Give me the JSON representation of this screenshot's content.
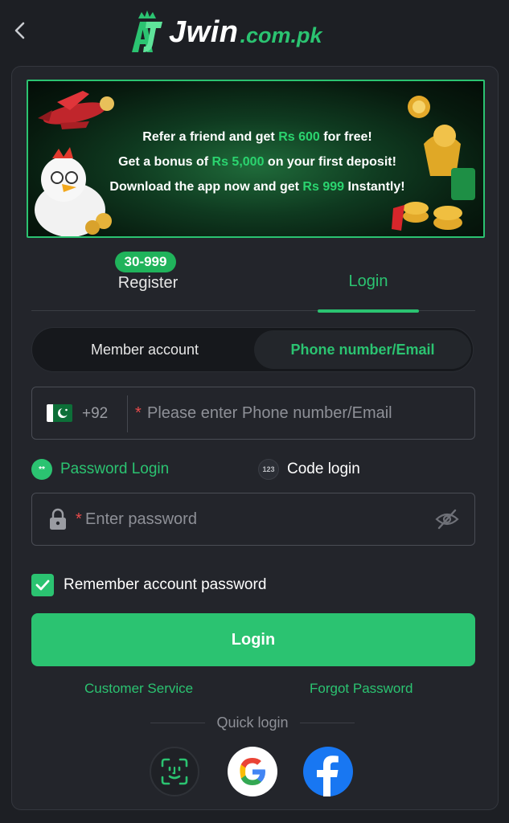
{
  "brand": {
    "logo_word": "Jwin",
    "logo_domain": ".com.pk"
  },
  "banner": {
    "line1": {
      "pre": "Refer a friend and get ",
      "hl": "Rs 600",
      "post": " for free!"
    },
    "line2": {
      "pre": "Get a bonus of ",
      "hl": "Rs 5,000",
      "post": " on your first deposit!"
    },
    "line3": {
      "pre": "Download the app now and get ",
      "hl": "Rs 999",
      "post": " Instantly!"
    }
  },
  "tabs": {
    "register_badge": "30-999",
    "register_label": "Register",
    "login_label": "Login",
    "active": "Login"
  },
  "account_type": {
    "member": "Member account",
    "phone": "Phone number/Email",
    "active": "Phone number/Email"
  },
  "phone_field": {
    "country_code": "+92",
    "required_mark": "*",
    "placeholder": "Please enter Phone number/Email",
    "value": ""
  },
  "login_mode": {
    "password_label": "Password Login",
    "password_icon": "**",
    "code_label": "Code login",
    "code_icon": "123",
    "active": "Password Login"
  },
  "password_field": {
    "required_mark": "*",
    "placeholder": "Enter password",
    "value": ""
  },
  "remember": {
    "label": "Remember account password",
    "checked": true
  },
  "login_button": "Login",
  "links": {
    "customer_service": "Customer Service",
    "forgot_password": "Forgot Password"
  },
  "quick_login": {
    "label": "Quick login",
    "providers": [
      "face-id-icon",
      "google-icon",
      "facebook-icon"
    ]
  },
  "colors": {
    "accent": "#2bc371",
    "background": "#1d1f24",
    "panel": "#23252b",
    "required": "#e84b4b",
    "facebook": "#1877f2"
  }
}
